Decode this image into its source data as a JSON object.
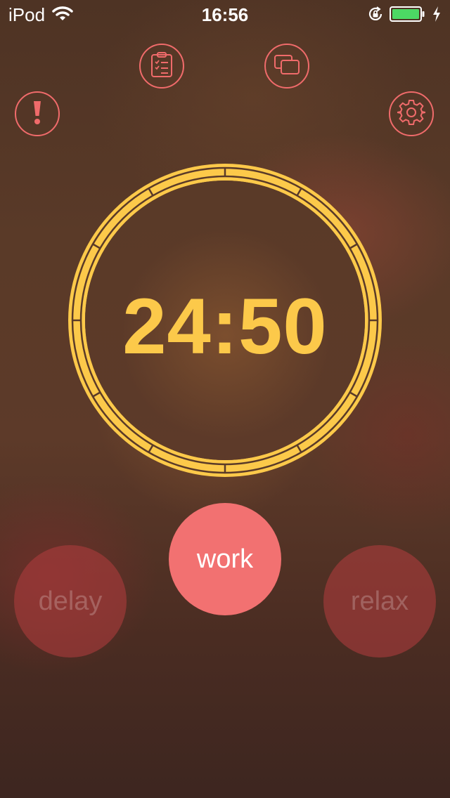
{
  "status_bar": {
    "carrier": "iPod",
    "time": "16:56",
    "battery_level": 1.0
  },
  "toolbar": {
    "icons": [
      "clipboard-icon",
      "windows-icon",
      "exclamation-icon",
      "gear-icon"
    ]
  },
  "timer": {
    "display": "24:50"
  },
  "buttons": {
    "work_label": "work",
    "delay_label": "delay",
    "relax_label": "relax"
  },
  "colors": {
    "accent": "#f06b6b",
    "timer": "#fcc94a",
    "work_button": "#f27171"
  }
}
